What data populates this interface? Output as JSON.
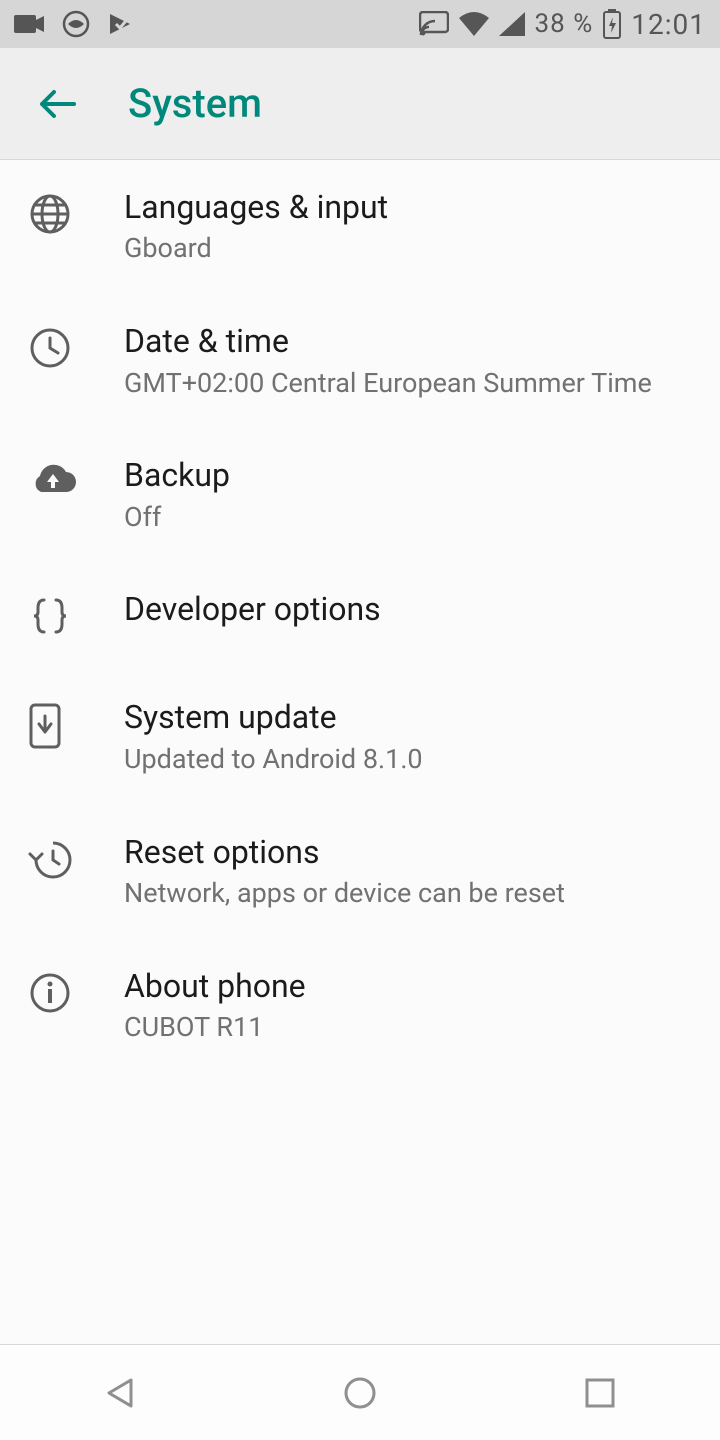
{
  "status_bar": {
    "battery_text": "38 %",
    "clock": "12:01"
  },
  "app_bar": {
    "title": "System"
  },
  "items": [
    {
      "icon": "globe",
      "title": "Languages & input",
      "subtitle": "Gboard"
    },
    {
      "icon": "clock",
      "title": "Date & time",
      "subtitle": "GMT+02:00 Central European Summer Time"
    },
    {
      "icon": "cloud-up",
      "title": "Backup",
      "subtitle": "Off"
    },
    {
      "icon": "braces",
      "title": "Developer options",
      "subtitle": ""
    },
    {
      "icon": "phone-down",
      "title": "System update",
      "subtitle": "Updated to Android 8.1.0"
    },
    {
      "icon": "restore",
      "title": "Reset options",
      "subtitle": "Network, apps or device can be reset"
    },
    {
      "icon": "info",
      "title": "About phone",
      "subtitle": "CUBOT R11"
    }
  ]
}
